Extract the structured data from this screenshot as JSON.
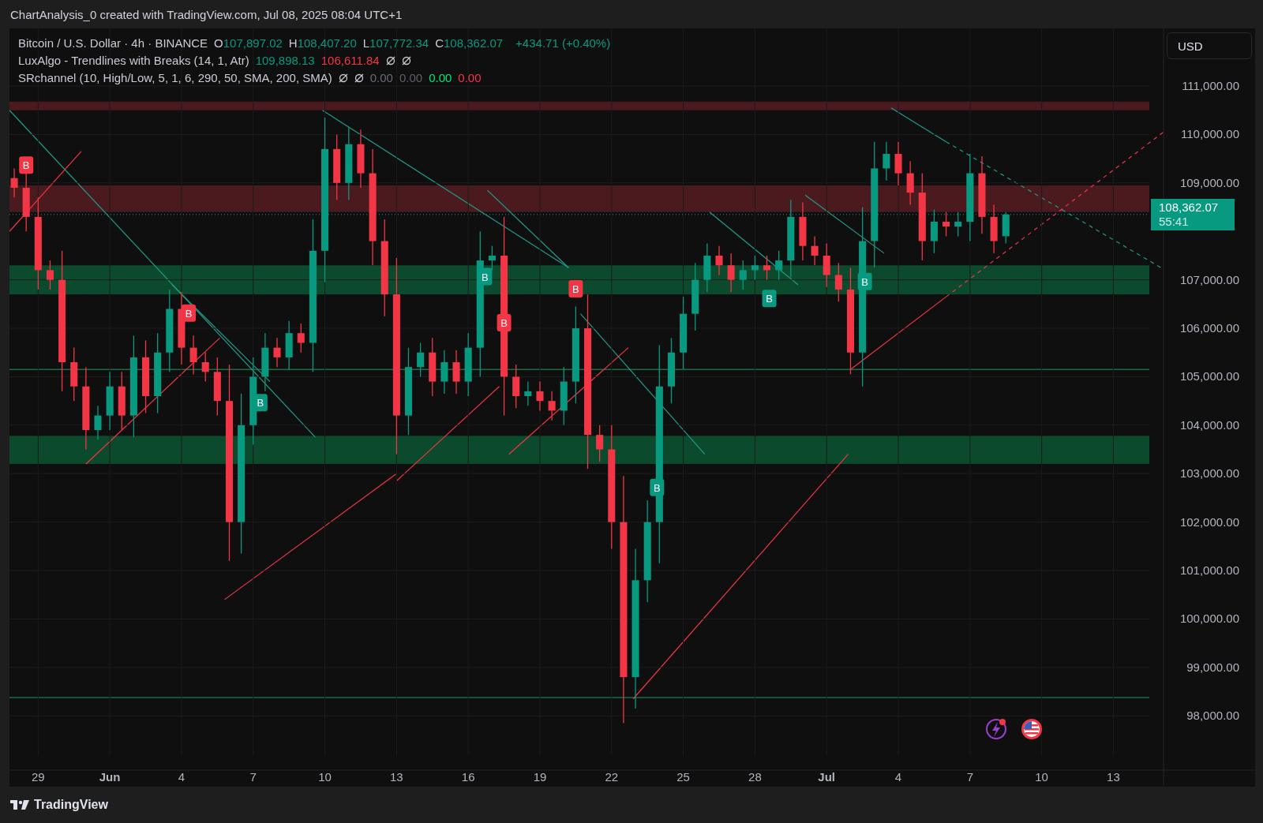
{
  "header": {
    "title": "ChartAnalysis_0 created with TradingView.com, Jul 08, 2025 08:04 UTC+1"
  },
  "legend": {
    "symbol": "Bitcoin / U.S. Dollar · 4h · BINANCE",
    "ohlc": [
      {
        "key": "O",
        "value": "107,897.02"
      },
      {
        "key": "H",
        "value": "108,407.20"
      },
      {
        "key": "L",
        "value": "107,772.34"
      },
      {
        "key": "C",
        "value": "108,362.07"
      }
    ],
    "change": "+434.71 (+0.40%)",
    "indicators": [
      {
        "name": "LuxAlgo - Trendlines with Breaks (14, 1, Atr)",
        "values": [
          {
            "text": "109,898.13",
            "color": "#089981"
          },
          {
            "text": "106,611.84",
            "color": "#f23645"
          }
        ]
      },
      {
        "name": "SRchannel (10, High/Low, 5, 1, 6, 290, 50, SMA, 200, SMA)",
        "values": [
          {
            "text": "0.00",
            "color": "#6a6d78"
          },
          {
            "text": "0.00",
            "color": "#5d606b"
          },
          {
            "text": "0.00",
            "color": "#00e676"
          },
          {
            "text": "0.00",
            "color": "#f23645"
          }
        ]
      }
    ]
  },
  "currency_button": "USD",
  "last_price": {
    "price": "108,362.07",
    "countdown": "55:41"
  },
  "chart_data": {
    "type": "candlestick",
    "categories": [
      null,
      null,
      "29",
      null,
      null,
      null,
      null,
      null,
      "Jun",
      null,
      null,
      null,
      null,
      null,
      "4",
      null,
      null,
      null,
      null,
      null,
      "7",
      null,
      null,
      null,
      null,
      null,
      "10",
      null,
      null,
      null,
      null,
      null,
      "13",
      null,
      null,
      null,
      null,
      null,
      "16",
      null,
      null,
      null,
      null,
      null,
      "19",
      null,
      null,
      null,
      null,
      null,
      "22",
      null,
      null,
      null,
      null,
      null,
      "25",
      null,
      null,
      null,
      null,
      null,
      "28",
      null,
      null,
      null,
      null,
      null,
      "Jul",
      null,
      null,
      null,
      null,
      null,
      "4",
      null,
      null,
      null,
      null,
      null,
      "7",
      null,
      null,
      null,
      null,
      null,
      "10",
      null,
      null,
      null,
      null,
      null,
      "13",
      null,
      null,
      null,
      null
    ],
    "ohlc": [
      [
        109100,
        109300,
        108700,
        108900
      ],
      [
        108900,
        109200,
        108000,
        108300
      ],
      [
        108300,
        108700,
        106800,
        107200
      ],
      [
        107200,
        107400,
        106800,
        107000
      ],
      [
        107000,
        107600,
        104700,
        105300
      ],
      [
        105300,
        105600,
        104500,
        104800
      ],
      [
        104800,
        105200,
        103500,
        103900
      ],
      [
        103900,
        104400,
        103700,
        104200
      ],
      [
        104200,
        105100,
        103900,
        104800
      ],
      [
        104800,
        105100,
        103900,
        104200
      ],
      [
        104200,
        105850,
        103750,
        105400
      ],
      [
        105400,
        105750,
        104250,
        104600
      ],
      [
        104600,
        105900,
        104250,
        105500
      ],
      [
        105500,
        106800,
        105100,
        106400
      ],
      [
        106400,
        106750,
        105250,
        105600
      ],
      [
        105600,
        105850,
        105050,
        105300
      ],
      [
        105300,
        105500,
        104900,
        105100
      ],
      [
        105100,
        105400,
        104200,
        104500
      ],
      [
        104500,
        105250,
        101200,
        102000
      ],
      [
        102000,
        104650,
        101350,
        104000
      ],
      [
        104000,
        105400,
        103600,
        105000
      ],
      [
        105000,
        105900,
        104700,
        105600
      ],
      [
        105600,
        105800,
        105200,
        105400
      ],
      [
        105400,
        106150,
        105150,
        105900
      ],
      [
        105900,
        106100,
        105500,
        105700
      ],
      [
        105700,
        108250,
        105100,
        107600
      ],
      [
        107600,
        110350,
        106950,
        109700
      ],
      [
        109700,
        110000,
        108650,
        109000
      ],
      [
        109000,
        110150,
        108650,
        109800
      ],
      [
        109800,
        110100,
        108900,
        109200
      ],
      [
        109200,
        109700,
        107300,
        107800
      ],
      [
        107800,
        108250,
        106250,
        106700
      ],
      [
        106700,
        107450,
        103400,
        104200
      ],
      [
        104200,
        105600,
        103800,
        105200
      ],
      [
        105200,
        105700,
        105000,
        105500
      ],
      [
        105500,
        105800,
        104600,
        104900
      ],
      [
        104900,
        105550,
        104650,
        105300
      ],
      [
        105300,
        105550,
        104650,
        104900
      ],
      [
        104900,
        105900,
        104600,
        105600
      ],
      [
        105600,
        108000,
        105000,
        107400
      ],
      [
        107400,
        107700,
        107200,
        107500
      ],
      [
        107500,
        108300,
        104200,
        105000
      ],
      [
        105000,
        105250,
        104350,
        104600
      ],
      [
        104600,
        104900,
        104400,
        104700
      ],
      [
        104700,
        104900,
        104300,
        104500
      ],
      [
        104500,
        104700,
        104100,
        104300
      ],
      [
        104300,
        105200,
        104000,
        104900
      ],
      [
        104900,
        106450,
        104450,
        106000
      ],
      [
        106000,
        106700,
        103100,
        103800
      ],
      [
        103800,
        104000,
        103250,
        103500
      ],
      [
        103500,
        104000,
        101450,
        102000
      ],
      [
        102000,
        102950,
        97850,
        98800
      ],
      [
        98800,
        101450,
        98150,
        100800
      ],
      [
        100800,
        102450,
        100350,
        102000
      ],
      [
        102000,
        105650,
        101150,
        104800
      ],
      [
        104800,
        105800,
        104450,
        105500
      ],
      [
        105500,
        106650,
        105150,
        106300
      ],
      [
        106300,
        107350,
        105950,
        107000
      ],
      [
        107000,
        107750,
        106750,
        107500
      ],
      [
        107500,
        107700,
        107100,
        107300
      ],
      [
        107300,
        107550,
        106750,
        107000
      ],
      [
        107000,
        107400,
        106800,
        107200
      ],
      [
        107200,
        107500,
        107000,
        107300
      ],
      [
        107300,
        107500,
        107000,
        107200
      ],
      [
        107200,
        107600,
        107000,
        107400
      ],
      [
        107400,
        108650,
        107050,
        108300
      ],
      [
        108300,
        108600,
        107400,
        107700
      ],
      [
        107700,
        107900,
        107300,
        107500
      ],
      [
        107500,
        107750,
        106850,
        107100
      ],
      [
        107100,
        107350,
        106550,
        106800
      ],
      [
        106800,
        107250,
        105050,
        105500
      ],
      [
        105500,
        108500,
        104800,
        107800
      ],
      [
        107800,
        109850,
        107250,
        109300
      ],
      [
        109300,
        109850,
        109050,
        109600
      ],
      [
        109600,
        109850,
        108950,
        109200
      ],
      [
        109200,
        109450,
        108550,
        108800
      ],
      [
        108800,
        109200,
        107400,
        107800
      ],
      [
        107800,
        108450,
        107550,
        108200
      ],
      [
        108200,
        108400,
        107900,
        108100
      ],
      [
        108100,
        108400,
        107900,
        108200
      ],
      [
        108200,
        109600,
        107800,
        109200
      ],
      [
        109200,
        109550,
        107950,
        108300
      ],
      [
        108300,
        108550,
        107550,
        107800
      ],
      [
        107900,
        108400,
        107750,
        108350
      ],
      null,
      null,
      null,
      null,
      null,
      null,
      null,
      null,
      null,
      null,
      null,
      null,
      null
    ],
    "ylim": [
      96880,
      112190
    ],
    "grid": true,
    "yticks": [
      {
        "value": 111000,
        "label": "111,000.00"
      },
      {
        "value": 110000,
        "label": "110,000.00"
      },
      {
        "value": 109000,
        "label": "109,000.00"
      },
      {
        "value": 107000,
        "label": "107,000.00"
      },
      {
        "value": 106000,
        "label": "106,000.00"
      },
      {
        "value": 105000,
        "label": "105,000.00"
      },
      {
        "value": 104000,
        "label": "104,000.00"
      },
      {
        "value": 103000,
        "label": "103,000.00"
      },
      {
        "value": 102000,
        "label": "102,000.00"
      },
      {
        "value": 101000,
        "label": "101,000.00"
      },
      {
        "value": 100000,
        "label": "100,000.00"
      },
      {
        "value": 99000,
        "label": "99,000.00"
      },
      {
        "value": 98000,
        "label": "98,000.00"
      }
    ]
  },
  "break_labels": [
    {
      "text": "B",
      "color": "#f23645"
    },
    {
      "text": "B",
      "color": "#f23645"
    },
    {
      "text": "B",
      "color": "#089981"
    },
    {
      "text": "B",
      "color": "#089981"
    },
    {
      "text": "B",
      "color": "#f23645"
    },
    {
      "text": "B",
      "color": "#f23645"
    },
    {
      "text": "B",
      "color": "#089981"
    },
    {
      "text": "B",
      "color": "#089981"
    },
    {
      "text": "B",
      "color": "#089981"
    }
  ],
  "footer": {
    "brand": "TradingView"
  }
}
